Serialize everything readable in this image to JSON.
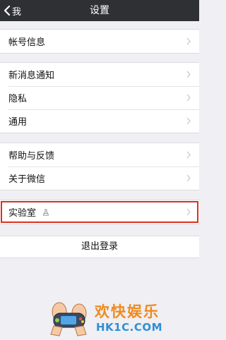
{
  "navbar": {
    "back_label": "我",
    "title": "设置"
  },
  "groups": {
    "account": [
      {
        "label": "帐号信息"
      }
    ],
    "general": [
      {
        "label": "新消息通知"
      },
      {
        "label": "隐私"
      },
      {
        "label": "通用"
      }
    ],
    "about": [
      {
        "label": "帮助与反馈"
      },
      {
        "label": "关于微信"
      }
    ],
    "lab": [
      {
        "label": "实验室",
        "icon": "lab-flask-icon"
      }
    ]
  },
  "logout_label": "退出登录",
  "watermark": {
    "cn": "欢快娱乐",
    "en": "HK1C.COM"
  },
  "colors": {
    "navbar": "#2e3034",
    "background": "#efeff4",
    "highlight": "#d9321f",
    "watermark_orange": "#f08a1c",
    "watermark_blue": "#2f8fd6"
  }
}
